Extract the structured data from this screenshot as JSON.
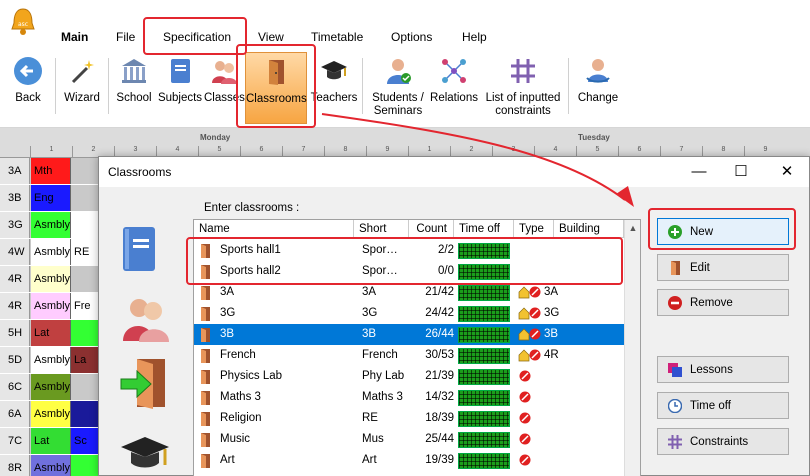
{
  "menu": [
    "Main",
    "File",
    "Specification",
    "View",
    "Timetable",
    "Options",
    "Help"
  ],
  "ribbon": {
    "back": "Back",
    "wizard": "Wizard",
    "school": "School",
    "subjects": "Subjects",
    "classes": "Classes",
    "classrooms": "Classrooms",
    "teachers": "Teachers",
    "students_line1": "Students /",
    "students_line2": "Seminars",
    "relations": "Relations",
    "constraints_line1": "List of inputted",
    "constraints_line2": "constraints",
    "change": "Change"
  },
  "timetable": {
    "days": [
      "Monday",
      "Tuesday"
    ],
    "periods": [
      "1",
      "2",
      "3",
      "4",
      "5",
      "6",
      "7",
      "8",
      "9",
      "1",
      "2",
      "3",
      "4",
      "5",
      "6",
      "7",
      "8",
      "9"
    ],
    "rows": [
      {
        "cls": "3A",
        "cells": [
          {
            "text": "Mth",
            "color": "#ff1a1a"
          }
        ]
      },
      {
        "cls": "3B",
        "cells": [
          {
            "text": "Eng",
            "color": "#1a1aff"
          }
        ]
      },
      {
        "cls": "3G",
        "cells": [
          {
            "text": "Asmbly",
            "color": "#33ff33"
          },
          {
            "text": "",
            "color": "#ffffff"
          }
        ]
      },
      {
        "cls": "4W",
        "cells": [
          {
            "text": "Asmbly",
            "color": "#ffffff"
          },
          {
            "text": "RE",
            "color": "#ffffff"
          }
        ]
      },
      {
        "cls": "4R",
        "cells": [
          {
            "text": "Asmbly",
            "color": "#ffffcc"
          },
          {
            "text": "",
            "color": "#c8c8c8"
          }
        ]
      },
      {
        "cls": "4R",
        "cells": [
          {
            "text": "Asmbly",
            "color": "#ffccff"
          },
          {
            "text": "Fre",
            "color": "#ffffff"
          }
        ]
      },
      {
        "cls": "5H",
        "cells": [
          {
            "text": "Lat",
            "color": "#c04040"
          },
          {
            "text": "",
            "color": "#33ff33"
          }
        ]
      },
      {
        "cls": "5D",
        "cells": [
          {
            "text": "Asmbly",
            "color": "#ffffff"
          },
          {
            "text": "La",
            "color": "#8b3030"
          }
        ]
      },
      {
        "cls": "6C",
        "cells": [
          {
            "text": "Asmbly",
            "color": "#6a9a20"
          }
        ]
      },
      {
        "cls": "6A",
        "cells": [
          {
            "text": "Asmbly",
            "color": "#ffff44"
          },
          {
            "text": "",
            "color": "#1a1a9a"
          }
        ]
      },
      {
        "cls": "7C",
        "cells": [
          {
            "text": "Lat",
            "color": "#33dd33"
          },
          {
            "text": "Sc",
            "color": "#1a1aff"
          }
        ]
      },
      {
        "cls": "8R",
        "cells": [
          {
            "text": "Asmbly",
            "color": "#7070dd"
          },
          {
            "text": "",
            "color": "#33ff33"
          }
        ]
      }
    ]
  },
  "dialog": {
    "title": "Classrooms",
    "minimize": "—",
    "maximize": "☐",
    "close": "✕",
    "enter_label": "Enter classrooms :",
    "columns": [
      "Name",
      "Short",
      "Count",
      "Time off",
      "Type",
      "Building"
    ],
    "rows": [
      {
        "name": "Sports hall1",
        "short": "Spor…",
        "count": "2/2",
        "type": "",
        "building": "",
        "selected": false
      },
      {
        "name": "Sports hall2",
        "short": "Spor…",
        "count": "0/0",
        "type": "",
        "building": "",
        "selected": false
      },
      {
        "name": "3A",
        "short": "3A",
        "count": "21/42",
        "type": "home-forbid",
        "building": "3A",
        "selected": false
      },
      {
        "name": "3G",
        "short": "3G",
        "count": "24/42",
        "type": "home-forbid",
        "building": "3G",
        "selected": false
      },
      {
        "name": "3B",
        "short": "3B",
        "count": "26/44",
        "type": "home-forbid",
        "building": "3B",
        "selected": true
      },
      {
        "name": "French",
        "short": "French",
        "count": "30/53",
        "type": "home-forbid",
        "building": "4R",
        "selected": false
      },
      {
        "name": "Physics Lab",
        "short": "Phy Lab",
        "count": "21/39",
        "type": "forbid",
        "building": "",
        "selected": false
      },
      {
        "name": "Maths 3",
        "short": "Maths 3",
        "count": "14/32",
        "type": "forbid",
        "building": "",
        "selected": false
      },
      {
        "name": "Religion",
        "short": "RE",
        "count": "18/39",
        "type": "forbid",
        "building": "",
        "selected": false
      },
      {
        "name": "Music",
        "short": "Mus",
        "count": "25/44",
        "type": "forbid",
        "building": "",
        "selected": false
      },
      {
        "name": "Art",
        "short": "Art",
        "count": "19/39",
        "type": "forbid",
        "building": "",
        "selected": false
      }
    ],
    "buttons": {
      "new": "New",
      "edit": "Edit",
      "remove": "Remove",
      "lessons": "Lessons",
      "time_off": "Time off",
      "constraints": "Constraints"
    }
  },
  "colors": {
    "accent": "#0078d7",
    "annotation": "#e3262f",
    "timeoff_green": "#1b9e1b"
  }
}
